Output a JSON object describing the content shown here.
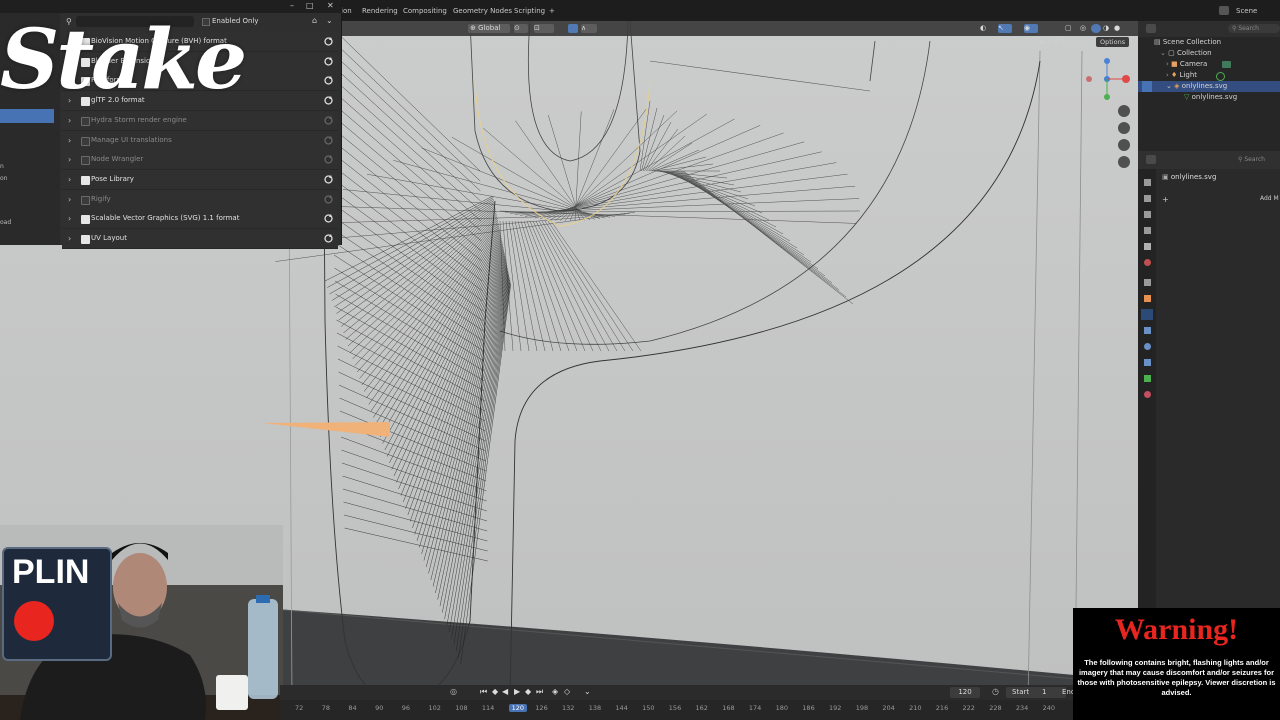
{
  "workspace_tabs": [
    "ion",
    "Rendering",
    "Compositing",
    "Geometry Nodes",
    "Scripting",
    "+"
  ],
  "top_right": {
    "scene_label": "Scene"
  },
  "viewport_header": {
    "orientation": "Global",
    "options_label": "Options",
    "axes": "X Y Z"
  },
  "outliner": {
    "rows": [
      {
        "label": "Scene Collection",
        "indent": 0,
        "selected": false
      },
      {
        "label": "Collection",
        "indent": 1,
        "selected": false
      },
      {
        "label": "Camera",
        "indent": 2,
        "selected": false
      },
      {
        "label": "Light",
        "indent": 2,
        "selected": false
      },
      {
        "label": "onlylines.svg",
        "indent": 2,
        "selected": true
      },
      {
        "label": "onlylines.svg",
        "indent": 3,
        "selected": false
      }
    ],
    "search_placeholder": "Search"
  },
  "properties": {
    "object_name": "onlylines.svg",
    "search_placeholder": "Search",
    "add_label": "Add M"
  },
  "preferences": {
    "filter_label": "Enabled Only",
    "sidebar_items": [
      "n",
      "on",
      "oad"
    ],
    "addons": [
      {
        "label": "BioVision Motion Capture (BVH) format",
        "enabled": true,
        "dim": false
      },
      {
        "label": "Blender Extensions",
        "enabled": true,
        "dim": false
      },
      {
        "label": "FBX format",
        "enabled": true,
        "dim": false
      },
      {
        "label": "glTF 2.0 format",
        "enabled": true,
        "dim": false
      },
      {
        "label": "Hydra Storm render engine",
        "enabled": false,
        "dim": true
      },
      {
        "label": "Manage UI translations",
        "enabled": false,
        "dim": true
      },
      {
        "label": "Node Wrangler",
        "enabled": false,
        "dim": true
      },
      {
        "label": "Pose Library",
        "enabled": true,
        "dim": false
      },
      {
        "label": "Rigify",
        "enabled": false,
        "dim": true
      },
      {
        "label": "Scalable Vector Graphics (SVG) 1.1 format",
        "enabled": true,
        "dim": false
      },
      {
        "label": "UV Layout",
        "enabled": true,
        "dim": false
      }
    ]
  },
  "overlay": {
    "logo_text": "Stake",
    "badge_text": "PLIN"
  },
  "timeline": {
    "current_frame": "120",
    "start_label": "Start",
    "start_value": "1",
    "end_label": "End",
    "ticks": [
      "72",
      "78",
      "84",
      "90",
      "96",
      "102",
      "108",
      "114",
      "120",
      "126",
      "132",
      "138",
      "144",
      "150",
      "156",
      "162",
      "168",
      "174",
      "180",
      "186",
      "192",
      "198",
      "204",
      "210",
      "216",
      "222",
      "228",
      "234",
      "240"
    ]
  },
  "warning": {
    "title": "Warning!",
    "body": "The following contains bright, flashing lights and/or imagery that may cause discomfort and/or seizures for those with photosensitive epilepsy. Viewer discretion is advised."
  },
  "colors": {
    "accent": "#4772b3",
    "warning_red": "#e8261f",
    "selection_orange": "#f0b070"
  }
}
